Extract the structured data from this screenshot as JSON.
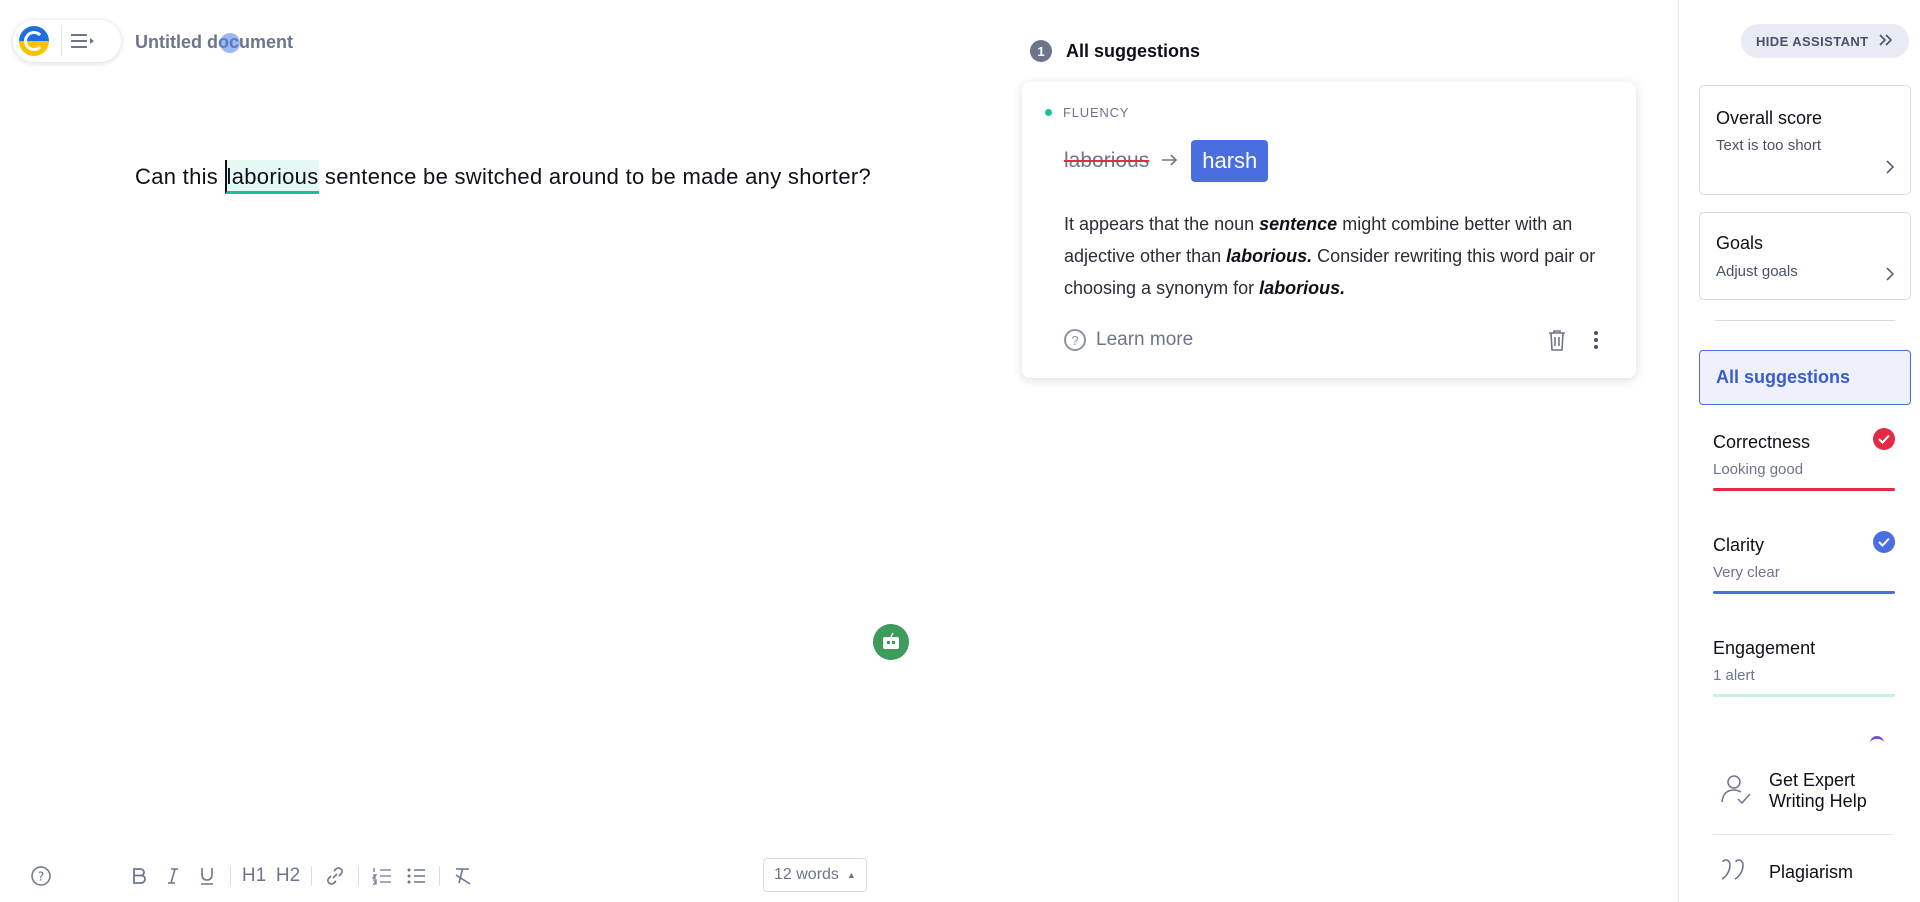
{
  "document": {
    "title": "Untitled document",
    "text_before": "Can this ",
    "text_highlight": "laborious",
    "text_after": " sentence be switched around to be made any shorter?"
  },
  "suggestions": {
    "count": "1",
    "header": "All suggestions",
    "card": {
      "category": "FLUENCY",
      "original": "laborious",
      "replacement": "harsh",
      "body_1": "It appears that the noun ",
      "body_em_1": "sentence",
      "body_2": " might combine better with an adjective other than ",
      "body_em_2": "laborious.",
      "body_3": " Consider rewriting this word pair or choosing a synonym for ",
      "body_em_3": "laborious.",
      "learn_more": "Learn more"
    }
  },
  "assistant": {
    "hide_label": "HIDE ASSISTANT",
    "overall": {
      "title": "Overall score",
      "sub": "Text is too short"
    },
    "goals": {
      "title": "Goals",
      "sub": "Adjust goals"
    },
    "all_suggestions": "All suggestions",
    "metrics": [
      {
        "title": "Correctness",
        "sub": "Looking good",
        "color": "#e22b45"
      },
      {
        "title": "Clarity",
        "sub": "Very clear",
        "color": "#4a6ee0"
      },
      {
        "title": "Engagement",
        "sub": "1 alert",
        "color": "#c9eee2"
      }
    ],
    "expert_line1": "Get Expert",
    "expert_line2": "Writing Help",
    "plagiarism": "Plagiarism"
  },
  "toolbar": {
    "h1": "H1",
    "h2": "H2",
    "word_count": "12 words"
  }
}
